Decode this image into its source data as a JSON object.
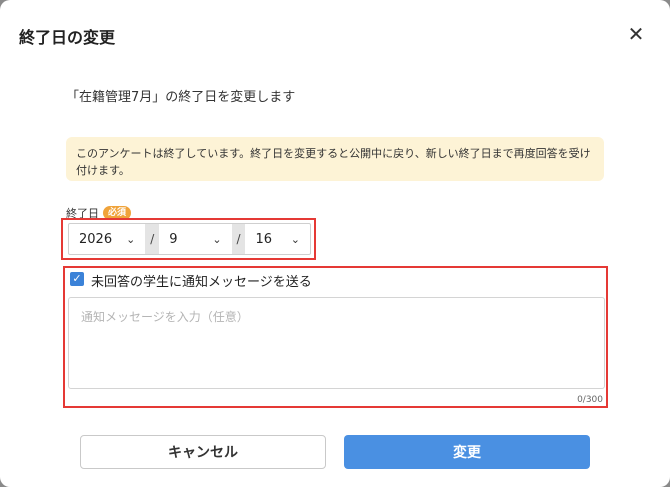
{
  "dialog": {
    "title": "終了日の変更",
    "close_glyph": "✕"
  },
  "subtitle": "「在籍管理7月」の終了日を変更します",
  "notice": "このアンケートは終了しています。終了日を変更すると公開中に戻り、新しい終了日まで再度回答を受け付けます。",
  "end_date": {
    "label": "終了日",
    "required_badge": "必須",
    "year": "2026",
    "month": "9",
    "day": "16",
    "separator": "/",
    "chevron": "⌄"
  },
  "notify": {
    "checked": true,
    "check_glyph": "✓",
    "label": "未回答の学生に通知メッセージを送る",
    "placeholder": "通知メッセージを入力（任意）",
    "counter": "0/300"
  },
  "buttons": {
    "cancel": "キャンセル",
    "confirm": "変更"
  }
}
